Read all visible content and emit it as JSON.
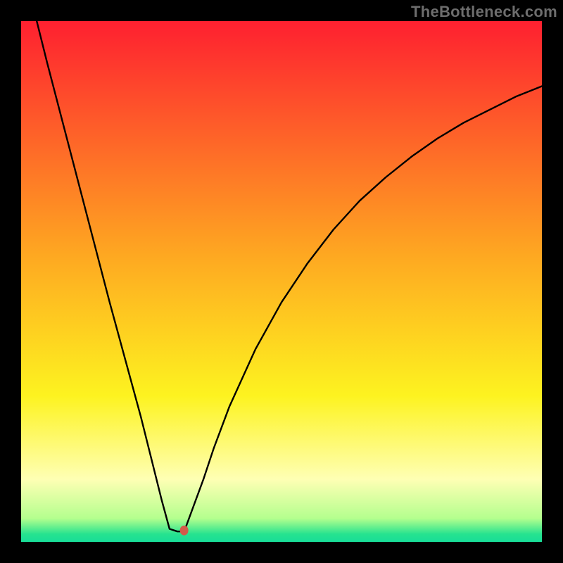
{
  "watermark": {
    "text": "TheBottleneck.com"
  },
  "chart_data": {
    "type": "line",
    "title": "",
    "xlabel": "",
    "ylabel": "",
    "xlim": [
      0,
      100
    ],
    "ylim": [
      0,
      100
    ],
    "series": [
      {
        "name": "curve",
        "x": [
          3,
          5,
          8,
          11,
          14,
          17,
          20,
          23,
          25,
          27,
          28.5,
          30,
          31,
          31.5,
          35,
          37,
          40,
          45,
          50,
          55,
          60,
          65,
          70,
          75,
          80,
          85,
          90,
          95,
          100
        ],
        "y": [
          100,
          92,
          80.5,
          69,
          57.5,
          46,
          35,
          24,
          16,
          8,
          2.5,
          2,
          2,
          2.5,
          12,
          18,
          26,
          37,
          46,
          53.5,
          60,
          65.5,
          70,
          74,
          77.5,
          80.5,
          83,
          85.5,
          87.5
        ]
      }
    ],
    "marker": {
      "x": 31.3,
      "y": 2.2,
      "color": "#d35a4a"
    },
    "background_gradient": {
      "stops": [
        {
          "offset": 0.0,
          "color": "#fe2030"
        },
        {
          "offset": 0.45,
          "color": "#fea821"
        },
        {
          "offset": 0.72,
          "color": "#fdf320"
        },
        {
          "offset": 0.88,
          "color": "#feffb4"
        },
        {
          "offset": 0.955,
          "color": "#b4ff8e"
        },
        {
          "offset": 0.985,
          "color": "#26e38f"
        },
        {
          "offset": 1.0,
          "color": "#18dd98"
        }
      ]
    }
  }
}
